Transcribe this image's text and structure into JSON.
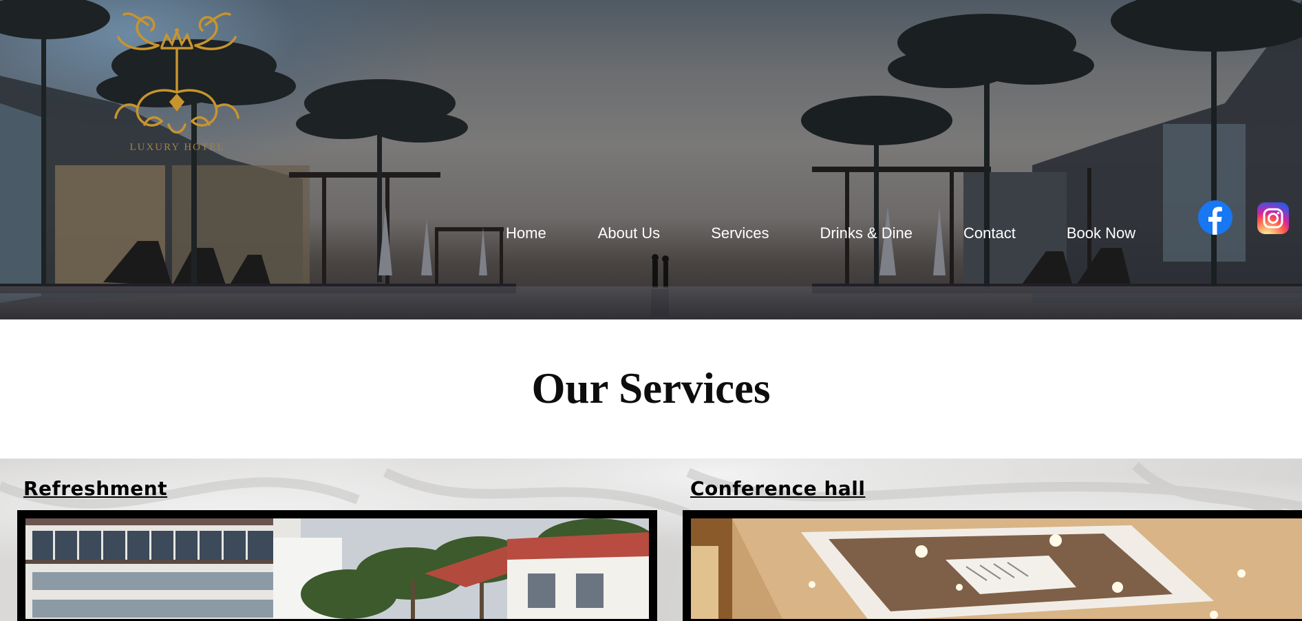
{
  "logo": {
    "text": "LUXURY HOTEL"
  },
  "nav": {
    "items": [
      "Home",
      "About Us",
      "Services",
      "Drinks & Dine",
      "Contact",
      "Book Now"
    ]
  },
  "social": {
    "facebook_icon": "facebook-icon",
    "instagram_icon": "instagram-icon"
  },
  "main": {
    "title": "Our Services",
    "services": [
      {
        "heading": "Refreshment"
      },
      {
        "heading": "Conference hall"
      }
    ]
  },
  "colors": {
    "logo_gold": "#c8942e",
    "facebook_blue": "#1877f2",
    "nav_text": "#ffffff"
  }
}
